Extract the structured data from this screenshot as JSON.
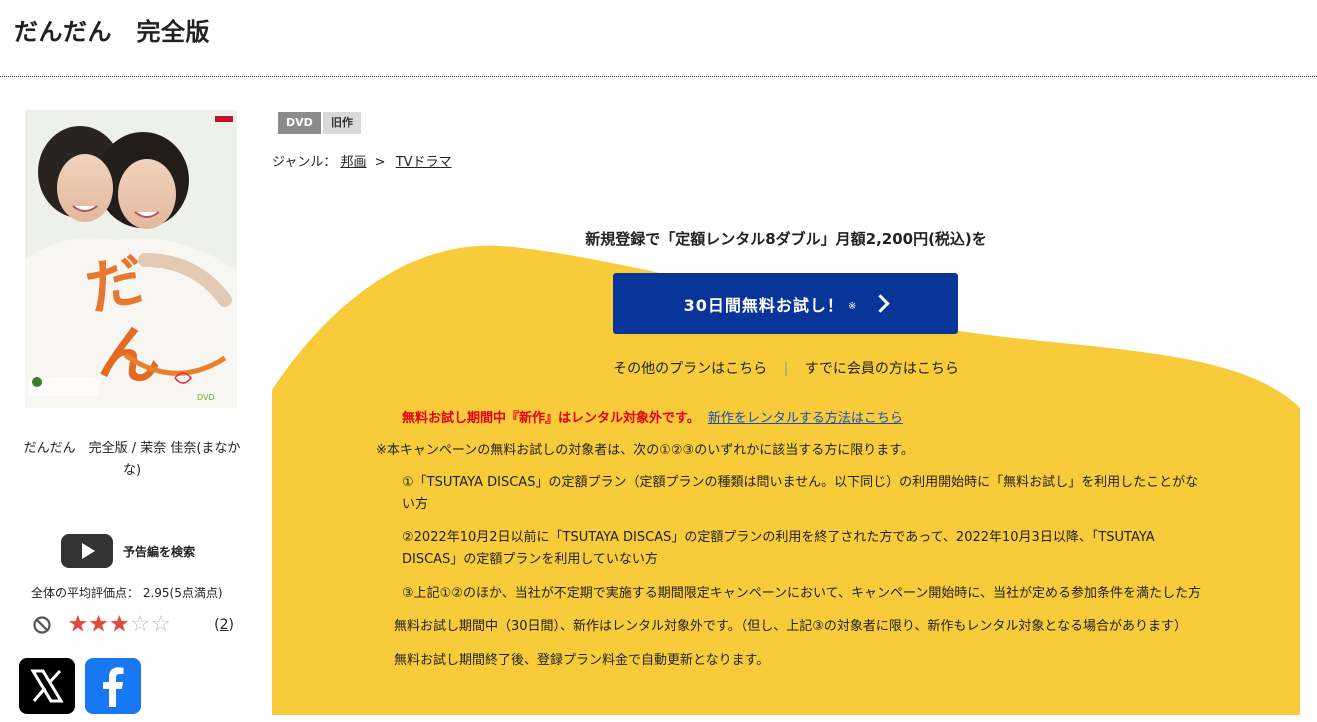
{
  "page": {
    "title": "だんだん　完全版"
  },
  "item": {
    "caption": "だんだん　完全版 / 茉奈 佳奈(まなかな)",
    "cover_text": "だんだん",
    "cover_badge": "DVD"
  },
  "trailer": {
    "label": "予告編を検索"
  },
  "rating": {
    "average_text": "全体の平均評価点：  2.95(5点満点)",
    "value": 2.95,
    "max": 5,
    "stars": [
      "★",
      "★",
      "★",
      "☆",
      "☆"
    ],
    "review_count": "2",
    "paren_open": "(",
    "paren_close": ")"
  },
  "tags": {
    "format": "DVD",
    "age": "旧作"
  },
  "genre": {
    "label": "ジャンル：",
    "path": [
      "邦画",
      "TVドラマ"
    ],
    "separator": ">"
  },
  "promo": {
    "headline": "新規登録で「定額レンタル8ダブル」月額2,200円(税込)を",
    "cta_label": "30日間無料お試し！",
    "cta_note": "※",
    "other_plans": "その他のプランはこちら",
    "divider": "|",
    "member_link": "すでに会員の方はこちら",
    "warning": "無料お試し期間中『新作』はレンタル対象外です。",
    "warning_link": "新作をレンタルする方法はこちら",
    "notes": [
      "※本キャンペーンの無料お試しの対象者は、次の①②③のいずれかに該当する方に限ります。",
      "①「TSUTAYA DISCAS」の定額プラン（定額プランの種類は問いません。以下同じ）の利用開始時に「無料お試し」を利用したことがない方",
      "②2022年10月2日以前に「TSUTAYA DISCAS」の定額プランの利用を終了された方であって、2022年10月3日以降、「TSUTAYA DISCAS」の定額プランを利用していない方",
      "③上記①②のほか、当社が不定期で実施する期間限定キャンペーンにおいて、キャンペーン開始時に、当社が定める参加条件を満たした方",
      "無料お試し期間中（30日間）、新作はレンタル対象外です。（但し、上記③の対象者に限り、新作もレンタル対象となる場合があります）",
      "無料お試し期間終了後、登録プラン料金で自動更新となります。"
    ]
  },
  "colors": {
    "promo_yellow": "#f8cb3a",
    "cta_blue": "#0a3598",
    "warning_red": "#e60012",
    "link_blue": "#1a4fb5",
    "star_red": "#e04a3a"
  },
  "icons": {
    "play": "youtube-play-icon",
    "no": "prohibited-icon",
    "x": "x-logo-icon",
    "facebook": "facebook-logo-icon",
    "chevron": "chevron-right-icon"
  }
}
